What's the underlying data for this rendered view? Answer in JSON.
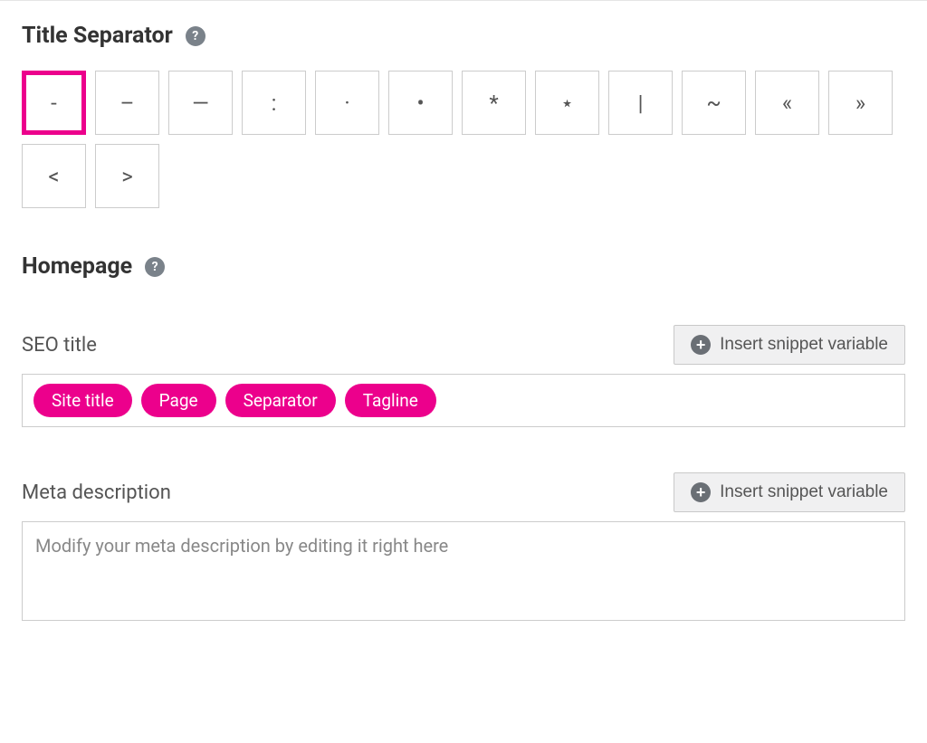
{
  "titleSeparator": {
    "heading": "Title Separator",
    "options": [
      "-",
      "–",
      "—",
      ":",
      "·",
      "•",
      "*",
      "⋆",
      "|",
      "~",
      "«",
      "»",
      "<",
      ">"
    ],
    "selectedIndex": 0
  },
  "homepage": {
    "heading": "Homepage",
    "seoTitle": {
      "label": "SEO title",
      "insertButton": "Insert snippet variable",
      "chips": [
        "Site title",
        "Page",
        "Separator",
        "Tagline"
      ]
    },
    "metaDescription": {
      "label": "Meta description",
      "insertButton": "Insert snippet variable",
      "placeholder": "Modify your meta description by editing it right here"
    }
  }
}
